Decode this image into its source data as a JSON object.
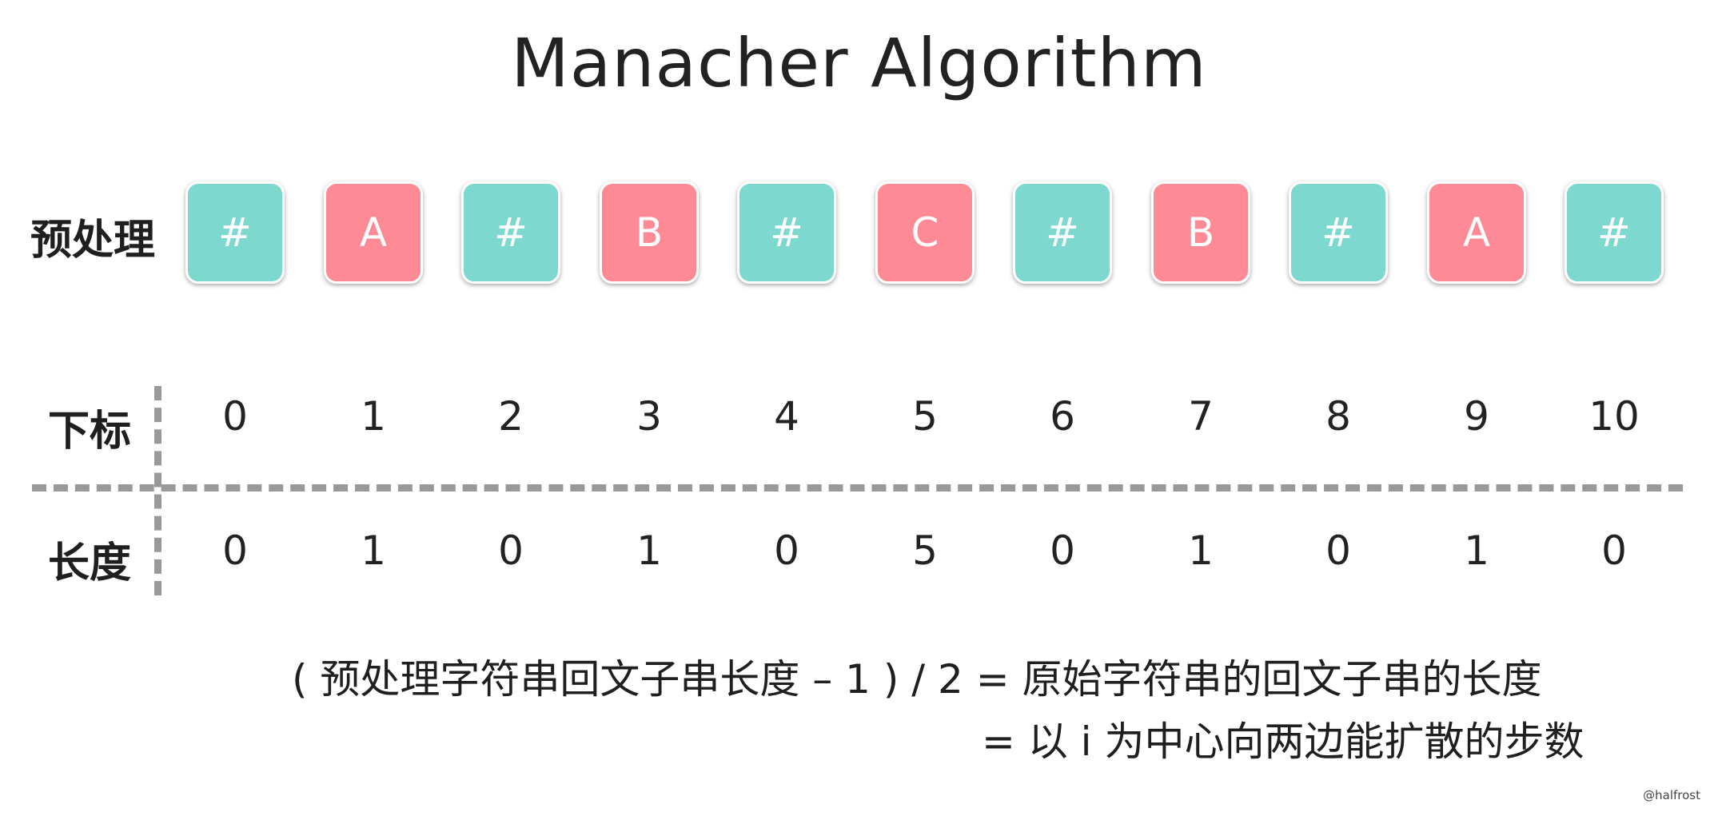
{
  "title": "Manacher Algorithm",
  "labels": {
    "preprocess": "预处理",
    "index": "下标",
    "length": "长度"
  },
  "cells": [
    {
      "char": "#",
      "kind": "sep"
    },
    {
      "char": "A",
      "kind": "chr"
    },
    {
      "char": "#",
      "kind": "sep"
    },
    {
      "char": "B",
      "kind": "chr"
    },
    {
      "char": "#",
      "kind": "sep"
    },
    {
      "char": "C",
      "kind": "chr"
    },
    {
      "char": "#",
      "kind": "sep"
    },
    {
      "char": "B",
      "kind": "chr"
    },
    {
      "char": "#",
      "kind": "sep"
    },
    {
      "char": "A",
      "kind": "chr"
    },
    {
      "char": "#",
      "kind": "sep"
    }
  ],
  "indices": [
    "0",
    "1",
    "2",
    "3",
    "4",
    "5",
    "6",
    "7",
    "8",
    "9",
    "10"
  ],
  "lengths": [
    "0",
    "1",
    "0",
    "1",
    "0",
    "5",
    "0",
    "1",
    "0",
    "1",
    "0"
  ],
  "colors": {
    "sep": "#7dd9cf",
    "chr": "#fd8a95",
    "divider": "#999999"
  },
  "formula": {
    "line1": "( 预处理字符串回文子串长度 – 1 ) / 2 = 原始字符串的回文子串的长度",
    "line2": "= 以 i 为中心向两边能扩散的步数"
  },
  "watermark": "@halfrost"
}
